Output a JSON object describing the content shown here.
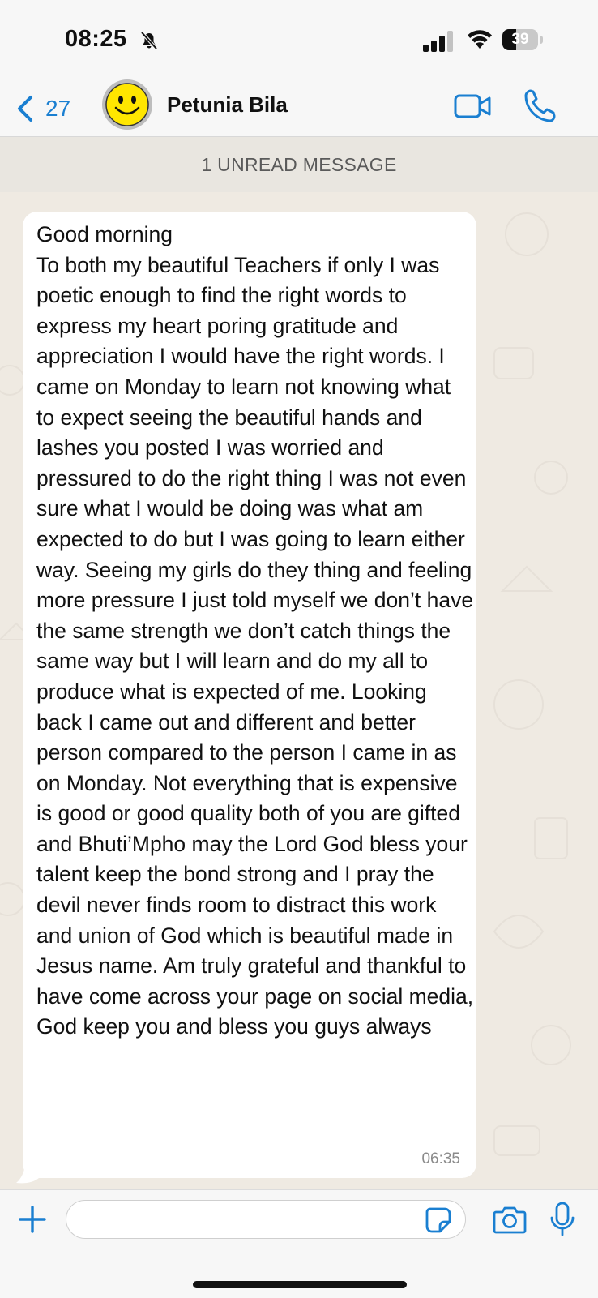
{
  "status_bar": {
    "time": "08:25",
    "battery_level": "39",
    "icons": [
      "bell-slash-icon",
      "signal-icon",
      "wifi-icon",
      "battery-icon"
    ]
  },
  "header": {
    "back_count": "27",
    "contact_name": "Petunia Bila",
    "icons": [
      "chevron-left-icon",
      "smiley-avatar",
      "video-camera-icon",
      "phone-icon"
    ]
  },
  "chat": {
    "unread_banner": "1 UNREAD MESSAGE",
    "messages": [
      {
        "text": "Good morning\nTo both my beautiful Teachers if only I was poetic enough to find the right words to express my heart poring gratitude and appreciation I would have the right words. I came on Monday to learn not knowing what to expect seeing the beautiful hands and lashes you posted I was worried and pressured to do the right thing I was not even sure what I would be doing was what am expected to do but I was going to learn either way. Seeing my girls do they thing and feeling more pressure I just told myself we don’t have the same strength we don’t catch things the same way but I will learn and do my all to produce what is expected of me. Looking back I came out and different and better person compared to the person I came in as on Monday. Not everything that is expensive is good or good quality both of you are gifted and Bhuti’Mpho may the Lord God bless your talent keep the bond strong and I pray the devil never finds room to distract this work and union of God which is beautiful made in Jesus name. Am truly grateful and thankful to have come across your page on social media, God keep you and bless you guys always",
        "time": "06:35"
      }
    ]
  },
  "composer": {
    "input_value": "",
    "icons": [
      "plus-icon",
      "sticker-icon",
      "camera-icon",
      "microphone-icon"
    ]
  },
  "colors": {
    "accent_blue": "#1a7fd1",
    "chat_background": "#efeae2",
    "bubble_background": "#ffffff",
    "avatar_yellow": "#ffe600"
  }
}
